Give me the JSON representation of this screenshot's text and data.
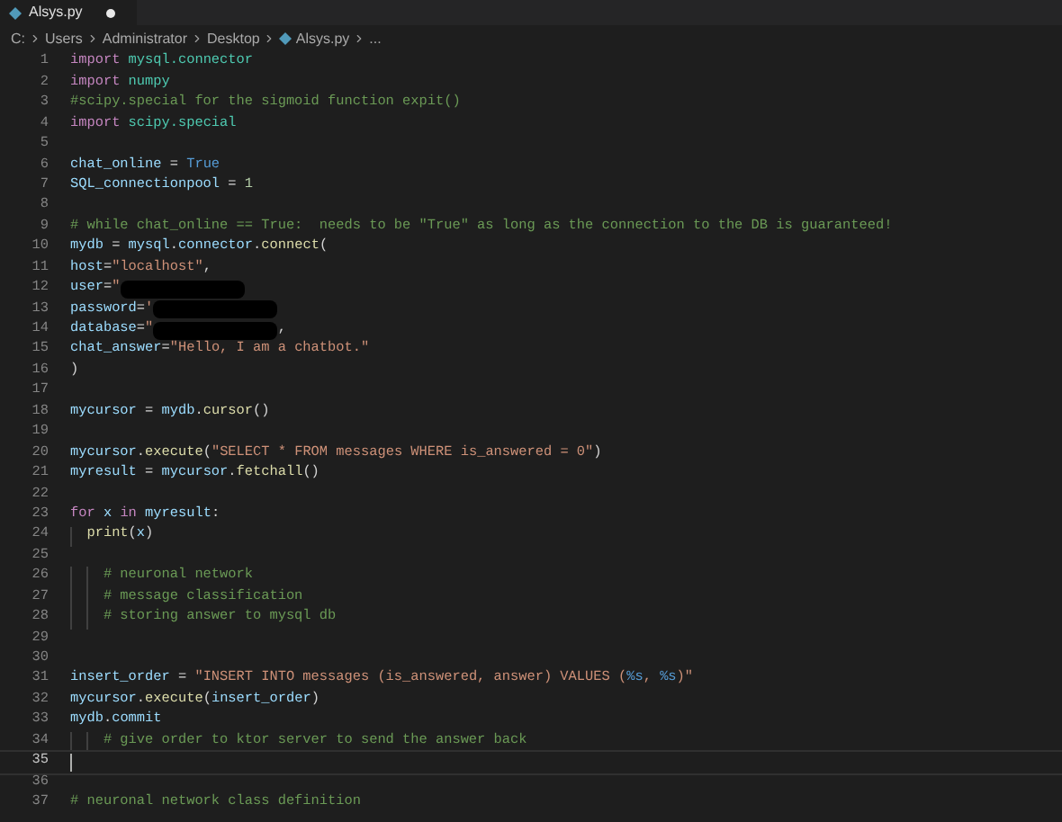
{
  "tab": {
    "label": "Alsys.py",
    "modified": true
  },
  "breadcrumb": [
    "C:",
    "Users",
    "Administrator",
    "Desktop",
    "Alsys.py",
    "..."
  ],
  "lines": [
    {
      "number": "1",
      "current": false,
      "tokens": [
        {
          "kind": "keyword",
          "text": "import "
        },
        {
          "kind": "module",
          "text": "mysql.connector"
        }
      ]
    },
    {
      "number": "2",
      "current": false,
      "tokens": [
        {
          "kind": "keyword",
          "text": "import "
        },
        {
          "kind": "module",
          "text": "numpy"
        }
      ]
    },
    {
      "number": "3",
      "current": false,
      "tokens": [
        {
          "kind": "comment",
          "text": "#scipy.special for the sigmoid function expit()"
        }
      ]
    },
    {
      "number": "4",
      "current": false,
      "tokens": [
        {
          "kind": "keyword",
          "text": "import "
        },
        {
          "kind": "module",
          "text": "scipy.special"
        }
      ]
    },
    {
      "number": "5",
      "current": false
    },
    {
      "number": "6",
      "current": false,
      "tokens": [
        {
          "kind": "variable",
          "text": "chat_online"
        },
        {
          "kind": "plain",
          "text": " = "
        },
        {
          "kind": "constant",
          "text": "True"
        }
      ]
    },
    {
      "number": "7",
      "current": false,
      "tokens": [
        {
          "kind": "variable",
          "text": "SQL_connectionpool"
        },
        {
          "kind": "plain",
          "text": " = "
        },
        {
          "kind": "number",
          "text": "1"
        }
      ]
    },
    {
      "number": "8",
      "current": false
    },
    {
      "number": "9",
      "current": false,
      "tokens": [
        {
          "kind": "comment",
          "text": "# while chat_online == True:  needs to be \"True\" as long as the connection to the DB is guaranteed!"
        }
      ]
    },
    {
      "number": "10",
      "current": false,
      "tokens": [
        {
          "kind": "variable",
          "text": "mydb"
        },
        {
          "kind": "plain",
          "text": " = "
        },
        {
          "kind": "variable",
          "text": "mysql"
        },
        {
          "kind": "plain",
          "text": "."
        },
        {
          "kind": "variable",
          "text": "connector"
        },
        {
          "kind": "plain",
          "text": "."
        },
        {
          "kind": "function",
          "text": "connect"
        },
        {
          "kind": "plain",
          "text": "("
        }
      ]
    },
    {
      "number": "11",
      "current": false,
      "tokens": [
        {
          "kind": "variable",
          "text": "host"
        },
        {
          "kind": "plain",
          "text": "="
        },
        {
          "kind": "string",
          "text": "\"localhost\""
        },
        {
          "kind": "plain",
          "text": ","
        }
      ]
    },
    {
      "number": "12",
      "current": false,
      "tokens": [
        {
          "kind": "variable",
          "text": "user"
        },
        {
          "kind": "plain",
          "text": "="
        },
        {
          "kind": "string",
          "text": "\""
        },
        {
          "kind": "redacted"
        }
      ]
    },
    {
      "number": "13",
      "current": false,
      "tokens": [
        {
          "kind": "variable",
          "text": "password"
        },
        {
          "kind": "plain",
          "text": "="
        },
        {
          "kind": "string",
          "text": "'"
        },
        {
          "kind": "redacted"
        }
      ]
    },
    {
      "number": "14",
      "current": false,
      "tokens": [
        {
          "kind": "variable",
          "text": "database"
        },
        {
          "kind": "plain",
          "text": "="
        },
        {
          "kind": "string",
          "text": "\""
        },
        {
          "kind": "redacted"
        },
        {
          "kind": "plain",
          "text": ","
        }
      ]
    },
    {
      "number": "15",
      "current": false,
      "tokens": [
        {
          "kind": "variable",
          "text": "chat_answer"
        },
        {
          "kind": "plain",
          "text": "="
        },
        {
          "kind": "string",
          "text": "\"Hello, I am a chatbot.\""
        }
      ]
    },
    {
      "number": "16",
      "current": false,
      "tokens": [
        {
          "kind": "plain",
          "text": ")"
        }
      ]
    },
    {
      "number": "17",
      "current": false
    },
    {
      "number": "18",
      "current": false,
      "tokens": [
        {
          "kind": "variable",
          "text": "mycursor"
        },
        {
          "kind": "plain",
          "text": " = "
        },
        {
          "kind": "variable",
          "text": "mydb"
        },
        {
          "kind": "plain",
          "text": "."
        },
        {
          "kind": "function",
          "text": "cursor"
        },
        {
          "kind": "plain",
          "text": "()"
        }
      ]
    },
    {
      "number": "19",
      "current": false
    },
    {
      "number": "20",
      "current": false,
      "tokens": [
        {
          "kind": "variable",
          "text": "mycursor"
        },
        {
          "kind": "plain",
          "text": "."
        },
        {
          "kind": "function",
          "text": "execute"
        },
        {
          "kind": "plain",
          "text": "("
        },
        {
          "kind": "string",
          "text": "\"SELECT * FROM messages WHERE is_answered = 0\""
        },
        {
          "kind": "plain",
          "text": ")"
        }
      ]
    },
    {
      "number": "21",
      "current": false,
      "tokens": [
        {
          "kind": "variable",
          "text": "myresult"
        },
        {
          "kind": "plain",
          "text": " = "
        },
        {
          "kind": "variable",
          "text": "mycursor"
        },
        {
          "kind": "plain",
          "text": "."
        },
        {
          "kind": "function",
          "text": "fetchall"
        },
        {
          "kind": "plain",
          "text": "()"
        }
      ]
    },
    {
      "number": "22",
      "current": false
    },
    {
      "number": "23",
      "current": false,
      "tokens": [
        {
          "kind": "keyword",
          "text": "for "
        },
        {
          "kind": "variable",
          "text": "x "
        },
        {
          "kind": "keyword",
          "text": "in "
        },
        {
          "kind": "variable",
          "text": "myresult"
        },
        {
          "kind": "plain",
          "text": ":"
        }
      ]
    },
    {
      "number": "24",
      "current": false,
      "tokens": [
        {
          "kind": "function",
          "text": "  print"
        },
        {
          "kind": "plain",
          "text": "("
        },
        {
          "kind": "variable",
          "text": "x"
        },
        {
          "kind": "plain",
          "text": ")"
        }
      ]
    },
    {
      "number": "25",
      "current": false
    },
    {
      "number": "26",
      "current": false,
      "tokens": [
        {
          "kind": "comment",
          "text": "    # neuronal network"
        }
      ]
    },
    {
      "number": "27",
      "current": false,
      "tokens": [
        {
          "kind": "comment",
          "text": "    # message classification"
        }
      ]
    },
    {
      "number": "28",
      "current": false,
      "tokens": [
        {
          "kind": "comment",
          "text": "    # storing answer to mysql db"
        }
      ]
    },
    {
      "number": "29",
      "current": false
    },
    {
      "number": "30",
      "current": false
    },
    {
      "number": "31",
      "current": false,
      "tokens": [
        {
          "kind": "variable",
          "text": "insert_order"
        },
        {
          "kind": "plain",
          "text": " = "
        },
        {
          "kind": "string",
          "text": "\"INSERT INTO messages (is_answered, answer) VALUES ("
        },
        {
          "kind": "placeholder",
          "text": "%s"
        },
        {
          "kind": "string",
          "text": ", "
        },
        {
          "kind": "placeholder",
          "text": "%s"
        },
        {
          "kind": "string",
          "text": ")\""
        }
      ]
    },
    {
      "number": "32",
      "current": false,
      "tokens": [
        {
          "kind": "variable",
          "text": "mycursor"
        },
        {
          "kind": "plain",
          "text": "."
        },
        {
          "kind": "function",
          "text": "execute"
        },
        {
          "kind": "plain",
          "text": "("
        },
        {
          "kind": "variable",
          "text": "insert_order"
        },
        {
          "kind": "plain",
          "text": ")"
        }
      ]
    },
    {
      "number": "33",
      "current": false,
      "tokens": [
        {
          "kind": "variable",
          "text": "mydb"
        },
        {
          "kind": "plain",
          "text": "."
        },
        {
          "kind": "variable",
          "text": "commit"
        }
      ]
    },
    {
      "number": "34",
      "current": false,
      "tokens": [
        {
          "kind": "comment",
          "text": "    # give order to ktor server to send the answer back"
        }
      ]
    },
    {
      "number": "35",
      "current": true
    },
    {
      "number": "36",
      "current": false
    },
    {
      "number": "37",
      "current": false,
      "tokens": [
        {
          "kind": "comment",
          "text": "# neuronal network class definition"
        }
      ]
    }
  ]
}
